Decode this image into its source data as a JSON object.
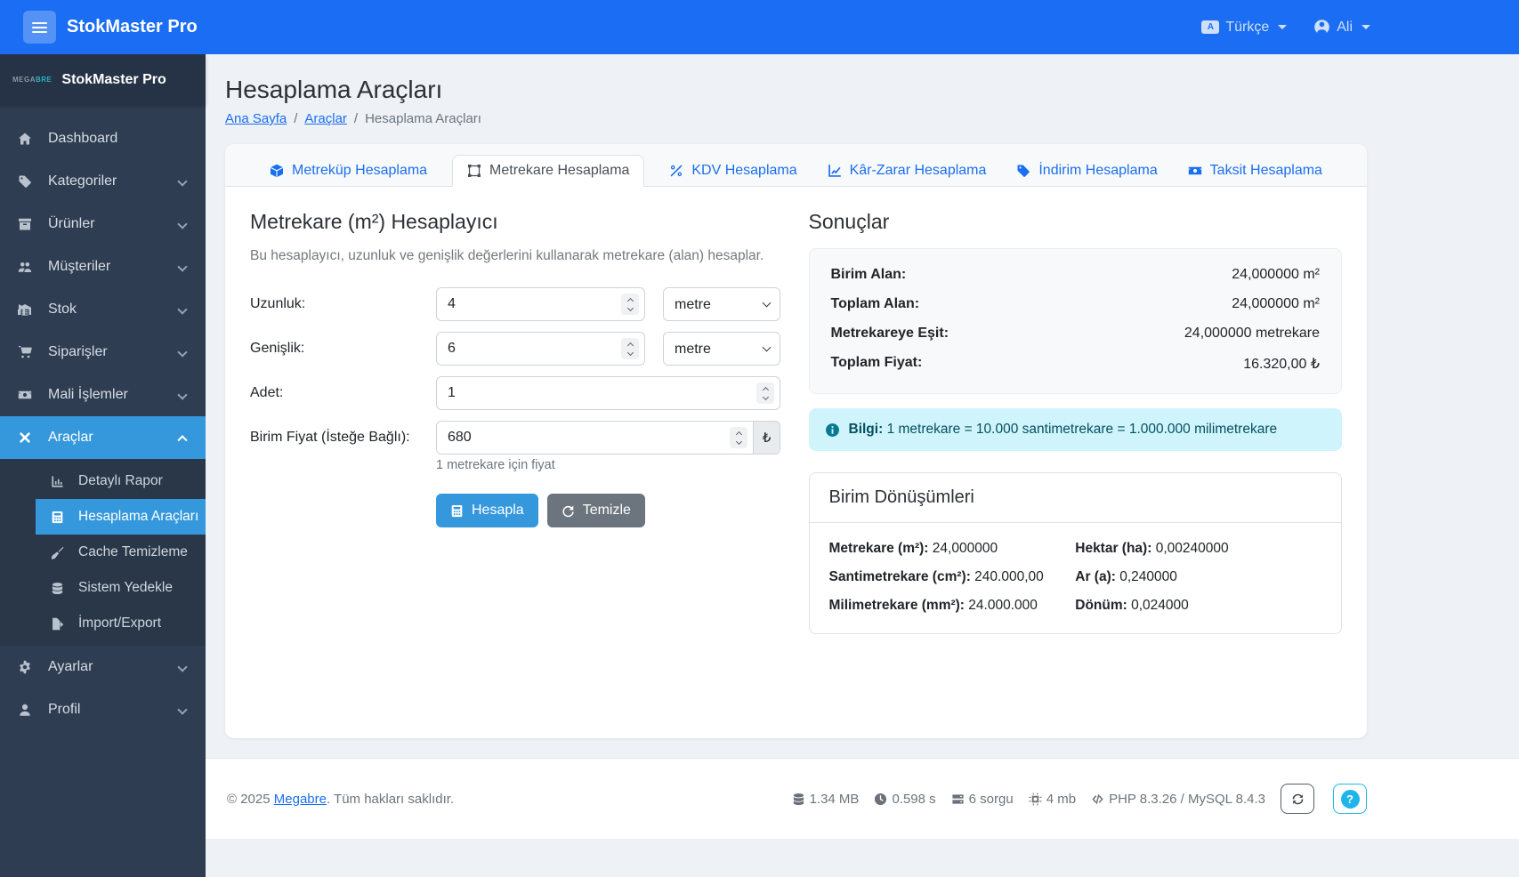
{
  "navbar": {
    "brand": "StokMaster Pro",
    "language": "Türkçe",
    "user": "Ali"
  },
  "sidebar": {
    "logo_part1": "MEGA",
    "logo_part2": "BRE",
    "brand": "StokMaster Pro",
    "items": [
      {
        "label": "Dashboard"
      },
      {
        "label": "Kategoriler"
      },
      {
        "label": "Ürünler"
      },
      {
        "label": "Müşteriler"
      },
      {
        "label": "Stok"
      },
      {
        "label": "Siparişler"
      },
      {
        "label": "Mali İşlemler"
      },
      {
        "label": "Araçlar"
      }
    ],
    "submenu": [
      {
        "label": "Detaylı Rapor"
      },
      {
        "label": "Hesaplama Araçları"
      },
      {
        "label": "Cache Temizleme"
      },
      {
        "label": "Sistem Yedekle"
      },
      {
        "label": "İmport/Export"
      }
    ],
    "items_bottom": [
      {
        "label": "Ayarlar"
      },
      {
        "label": "Profil"
      }
    ]
  },
  "page": {
    "title": "Hesaplama Araçları",
    "breadcrumb": [
      {
        "label": "Ana Sayfa"
      },
      {
        "label": "Araçlar"
      },
      {
        "label": "Hesaplama Araçları"
      }
    ]
  },
  "tabs": [
    {
      "label": "Metreküp Hesaplama"
    },
    {
      "label": "Metrekare Hesaplama"
    },
    {
      "label": "KDV Hesaplama"
    },
    {
      "label": "Kâr-Zarar Hesaplama"
    },
    {
      "label": "İndirim Hesaplama"
    },
    {
      "label": "Taksit Hesaplama"
    }
  ],
  "calculator": {
    "title": "Metrekare (m²) Hesaplayıcı",
    "description": "Bu hesaplayıcı, uzunluk ve genişlik değerlerini kullanarak metrekare (alan) hesaplar.",
    "fields": {
      "length": {
        "label": "Uzunluk:",
        "value": "4",
        "unit": "metre"
      },
      "width": {
        "label": "Genişlik:",
        "value": "6",
        "unit": "metre"
      },
      "quantity": {
        "label": "Adet:",
        "value": "1"
      },
      "unit_price": {
        "label": "Birim Fiyat (İsteğe Bağlı):",
        "value": "680",
        "addon": "₺",
        "help": "1 metrekare için fiyat"
      }
    },
    "buttons": {
      "calculate": "Hesapla",
      "clear": "Temizle"
    }
  },
  "results": {
    "title": "Sonuçlar",
    "rows": [
      {
        "label": "Birim Alan:",
        "value": "24,000000 m²"
      },
      {
        "label": "Toplam Alan:",
        "value": "24,000000 m²"
      },
      {
        "label": "Metrekareye Eşit:",
        "value": "24,000000 metrekare"
      },
      {
        "label": "Toplam Fiyat:",
        "value": "16.320,00 ₺"
      }
    ],
    "info_label": "Bilgi:",
    "info_text": "1 metrekare = 10.000 santimetrekare = 1.000.000 milimetrekare"
  },
  "conversions": {
    "title": "Birim Dönüşümleri",
    "left": [
      {
        "label": "Metrekare (m²):",
        "value": "24,000000"
      },
      {
        "label": "Santimetrekare (cm²):",
        "value": "240.000,00"
      },
      {
        "label": "Milimetrekare (mm²):",
        "value": "24.000.000"
      }
    ],
    "right": [
      {
        "label": "Hektar (ha):",
        "value": "0,00240000"
      },
      {
        "label": "Ar (a):",
        "value": "0,240000"
      },
      {
        "label": "Dönüm:",
        "value": "0,024000"
      }
    ]
  },
  "footer": {
    "copyright_prefix": "© 2025",
    "copyright_link": "Megabre",
    "copyright_suffix": ". Tüm hakları saklıdır.",
    "stats": [
      {
        "text": "1.34 MB"
      },
      {
        "text": "0.598 s"
      },
      {
        "text": "6 sorgu"
      },
      {
        "text": "4 mb"
      },
      {
        "text": "PHP 8.3.26 / MySQL 8.4.3"
      }
    ],
    "help_label": "?"
  }
}
